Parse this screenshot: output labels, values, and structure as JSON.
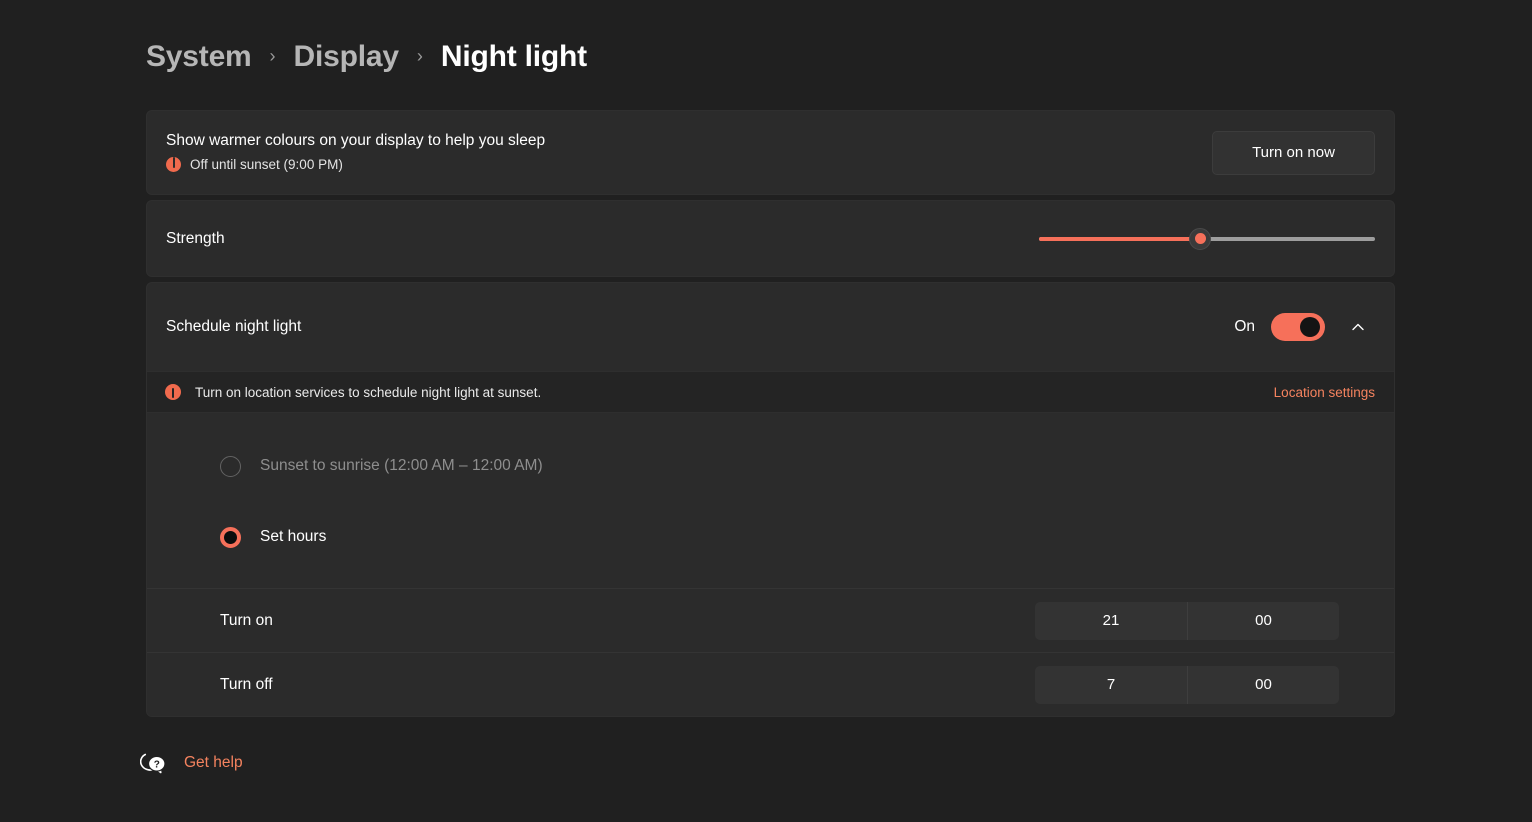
{
  "breadcrumb": {
    "items": [
      {
        "label": "System",
        "current": false
      },
      {
        "label": "Display",
        "current": false
      },
      {
        "label": "Night light",
        "current": true
      }
    ],
    "separator": "›"
  },
  "summary_card": {
    "title": "Show warmer colours on your display to help you sleep",
    "status_icon": "info-icon",
    "status_text": "Off until sunset (9:00 PM)",
    "button_label": "Turn on now"
  },
  "strength_card": {
    "label": "Strength",
    "slider": {
      "value": 48,
      "min": 0,
      "max": 100,
      "fill_color": "#f6705a",
      "track_color": "#9d9d9d"
    }
  },
  "schedule_card": {
    "label": "Schedule night light",
    "toggle_state_label": "On",
    "toggle_on": true,
    "toggle_color": "#f6705a",
    "expander_icon": "chevron-up-icon",
    "expanded": true,
    "warning": {
      "icon": "alert-icon",
      "text": "Turn on location services to schedule night light at sunset.",
      "link_label": "Location settings",
      "link_color": "#f5835f"
    },
    "options": [
      {
        "label": "Sunset to sunrise (12:00 AM – 12:00 AM)",
        "selected": false,
        "disabled": true
      },
      {
        "label": "Set hours",
        "selected": true,
        "disabled": false
      }
    ],
    "times": [
      {
        "label": "Turn on",
        "hour": "21",
        "minute": "00"
      },
      {
        "label": "Turn off",
        "hour": "7",
        "minute": "00"
      }
    ]
  },
  "footer": {
    "help_icon": "help-bubble-icon",
    "help_label": "Get help"
  }
}
